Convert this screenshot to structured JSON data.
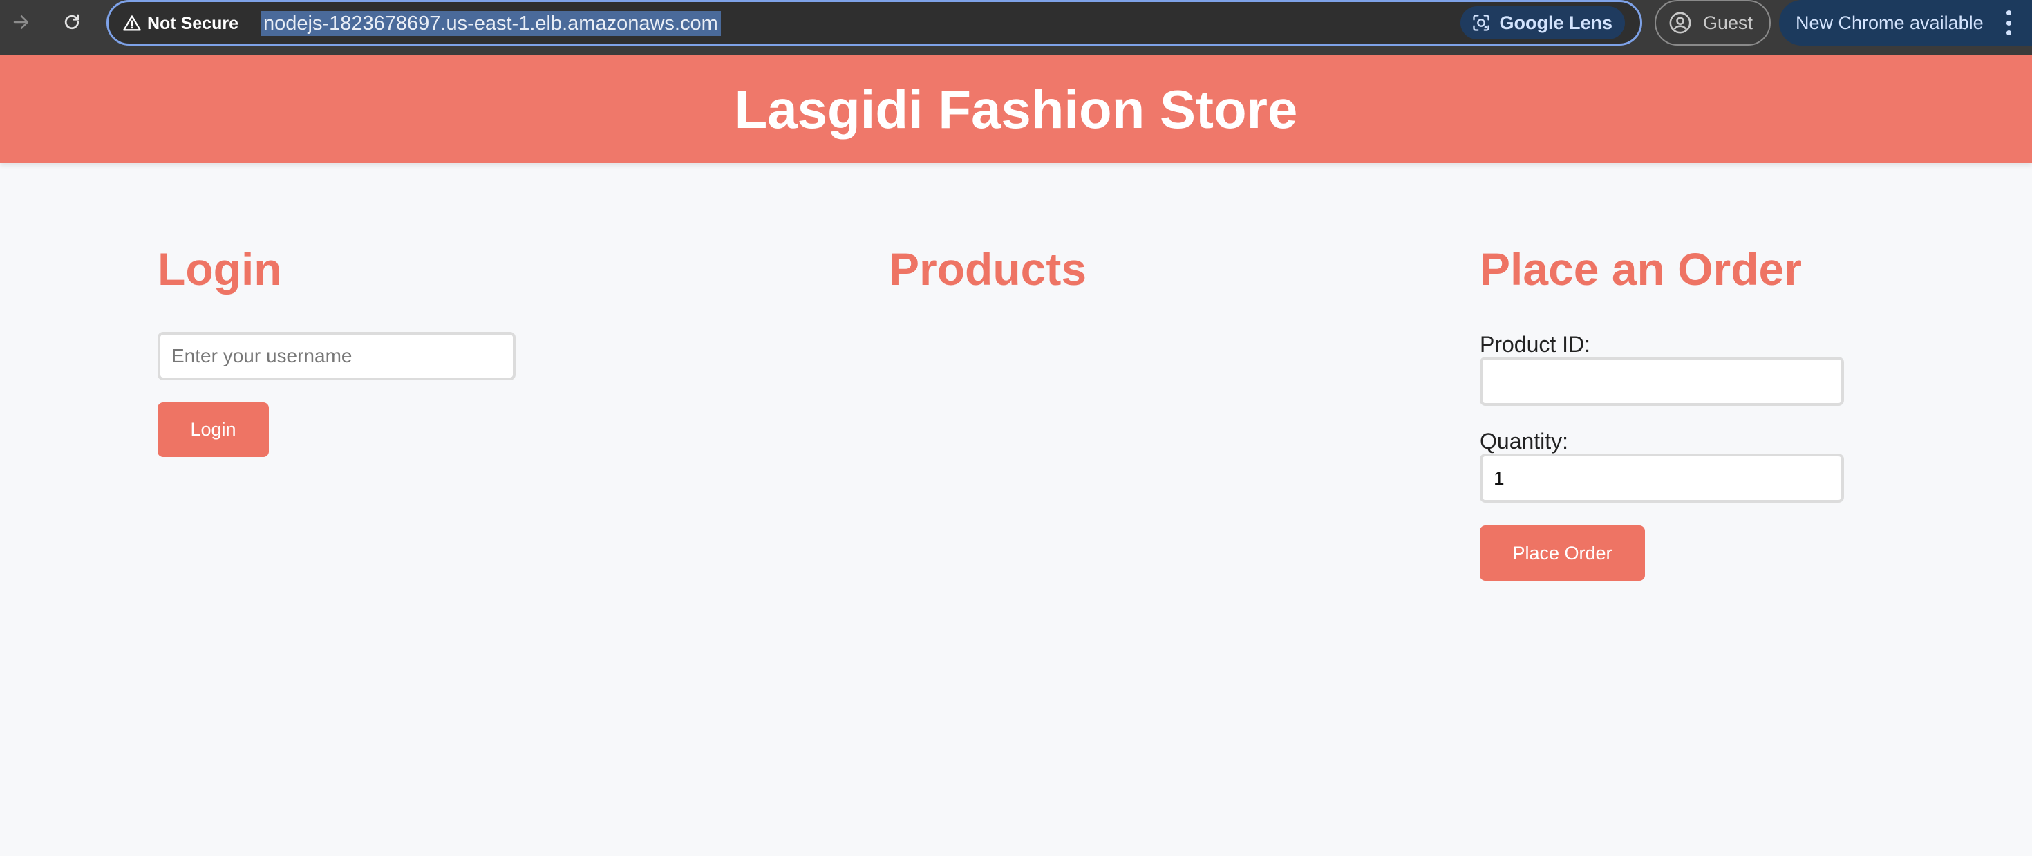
{
  "browser": {
    "security_label": "Not Secure",
    "url": "nodejs-1823678697.us-east-1.elb.amazonaws.com",
    "lens_label": "Google Lens",
    "profile_label": "Guest",
    "update_label": "New Chrome available"
  },
  "header": {
    "title": "Lasgidi Fashion Store"
  },
  "login": {
    "heading": "Login",
    "username_placeholder": "Enter your username",
    "username_value": "",
    "button_label": "Login"
  },
  "products": {
    "heading": "Products"
  },
  "order": {
    "heading": "Place an Order",
    "product_id_label": "Product ID:",
    "product_id_value": "",
    "quantity_label": "Quantity:",
    "quantity_value": "1",
    "button_label": "Place Order"
  },
  "colors": {
    "accent": "#ee7464",
    "header_bg": "#ef786a",
    "page_bg": "#f7f8fa"
  }
}
